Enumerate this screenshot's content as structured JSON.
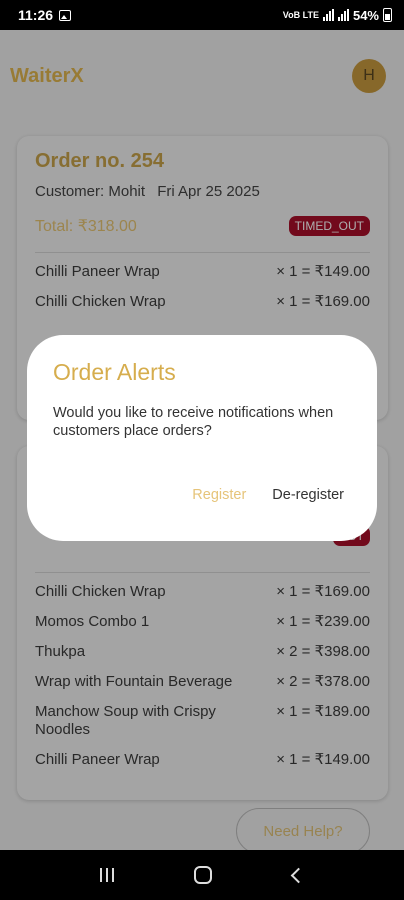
{
  "status_bar": {
    "time": "11:26",
    "battery": "54%",
    "network": "VoB LTE"
  },
  "header": {
    "app_name": "WaiterX",
    "avatar_initial": "H"
  },
  "orders": [
    {
      "title": "Order no. 254",
      "customer": "Customer: Mohit",
      "date": "Fri Apr 25 2025",
      "total": "Total: ₹318.00",
      "status": "TIMED_OUT",
      "items": [
        {
          "name": "Chilli Paneer Wrap",
          "price": "× 1 = ₹149.00"
        },
        {
          "name": "Chilli Chicken Wrap",
          "price": "× 1 = ₹169.00"
        }
      ]
    },
    {
      "title": "",
      "customer": "",
      "date": "",
      "total": "",
      "status": "OUT",
      "items": [
        {
          "name": "Chilli Chicken Wrap",
          "price": "× 1 = ₹169.00"
        },
        {
          "name": "Momos Combo 1",
          "price": "× 1 = ₹239.00"
        },
        {
          "name": "Thukpa",
          "price": "× 2 = ₹398.00"
        },
        {
          "name": "Wrap with Fountain Beverage",
          "price": "× 2 = ₹378.00"
        },
        {
          "name": "Manchow Soup with Crispy Noodles",
          "price": "× 1 = ₹189.00"
        },
        {
          "name": "Chilli Paneer Wrap",
          "price": "× 1 = ₹149.00"
        }
      ]
    }
  ],
  "help_button": "Need Help?",
  "dialog": {
    "title": "Order Alerts",
    "message": "Would you like to receive notifications when customers place orders?",
    "register": "Register",
    "deregister": "De-register"
  },
  "colors": {
    "accent": "#d6ad4d",
    "badge": "#a8102a"
  },
  "icons": [
    "image-icon",
    "signal-icon",
    "battery-icon",
    "recents-icon",
    "home-icon",
    "back-icon"
  ]
}
